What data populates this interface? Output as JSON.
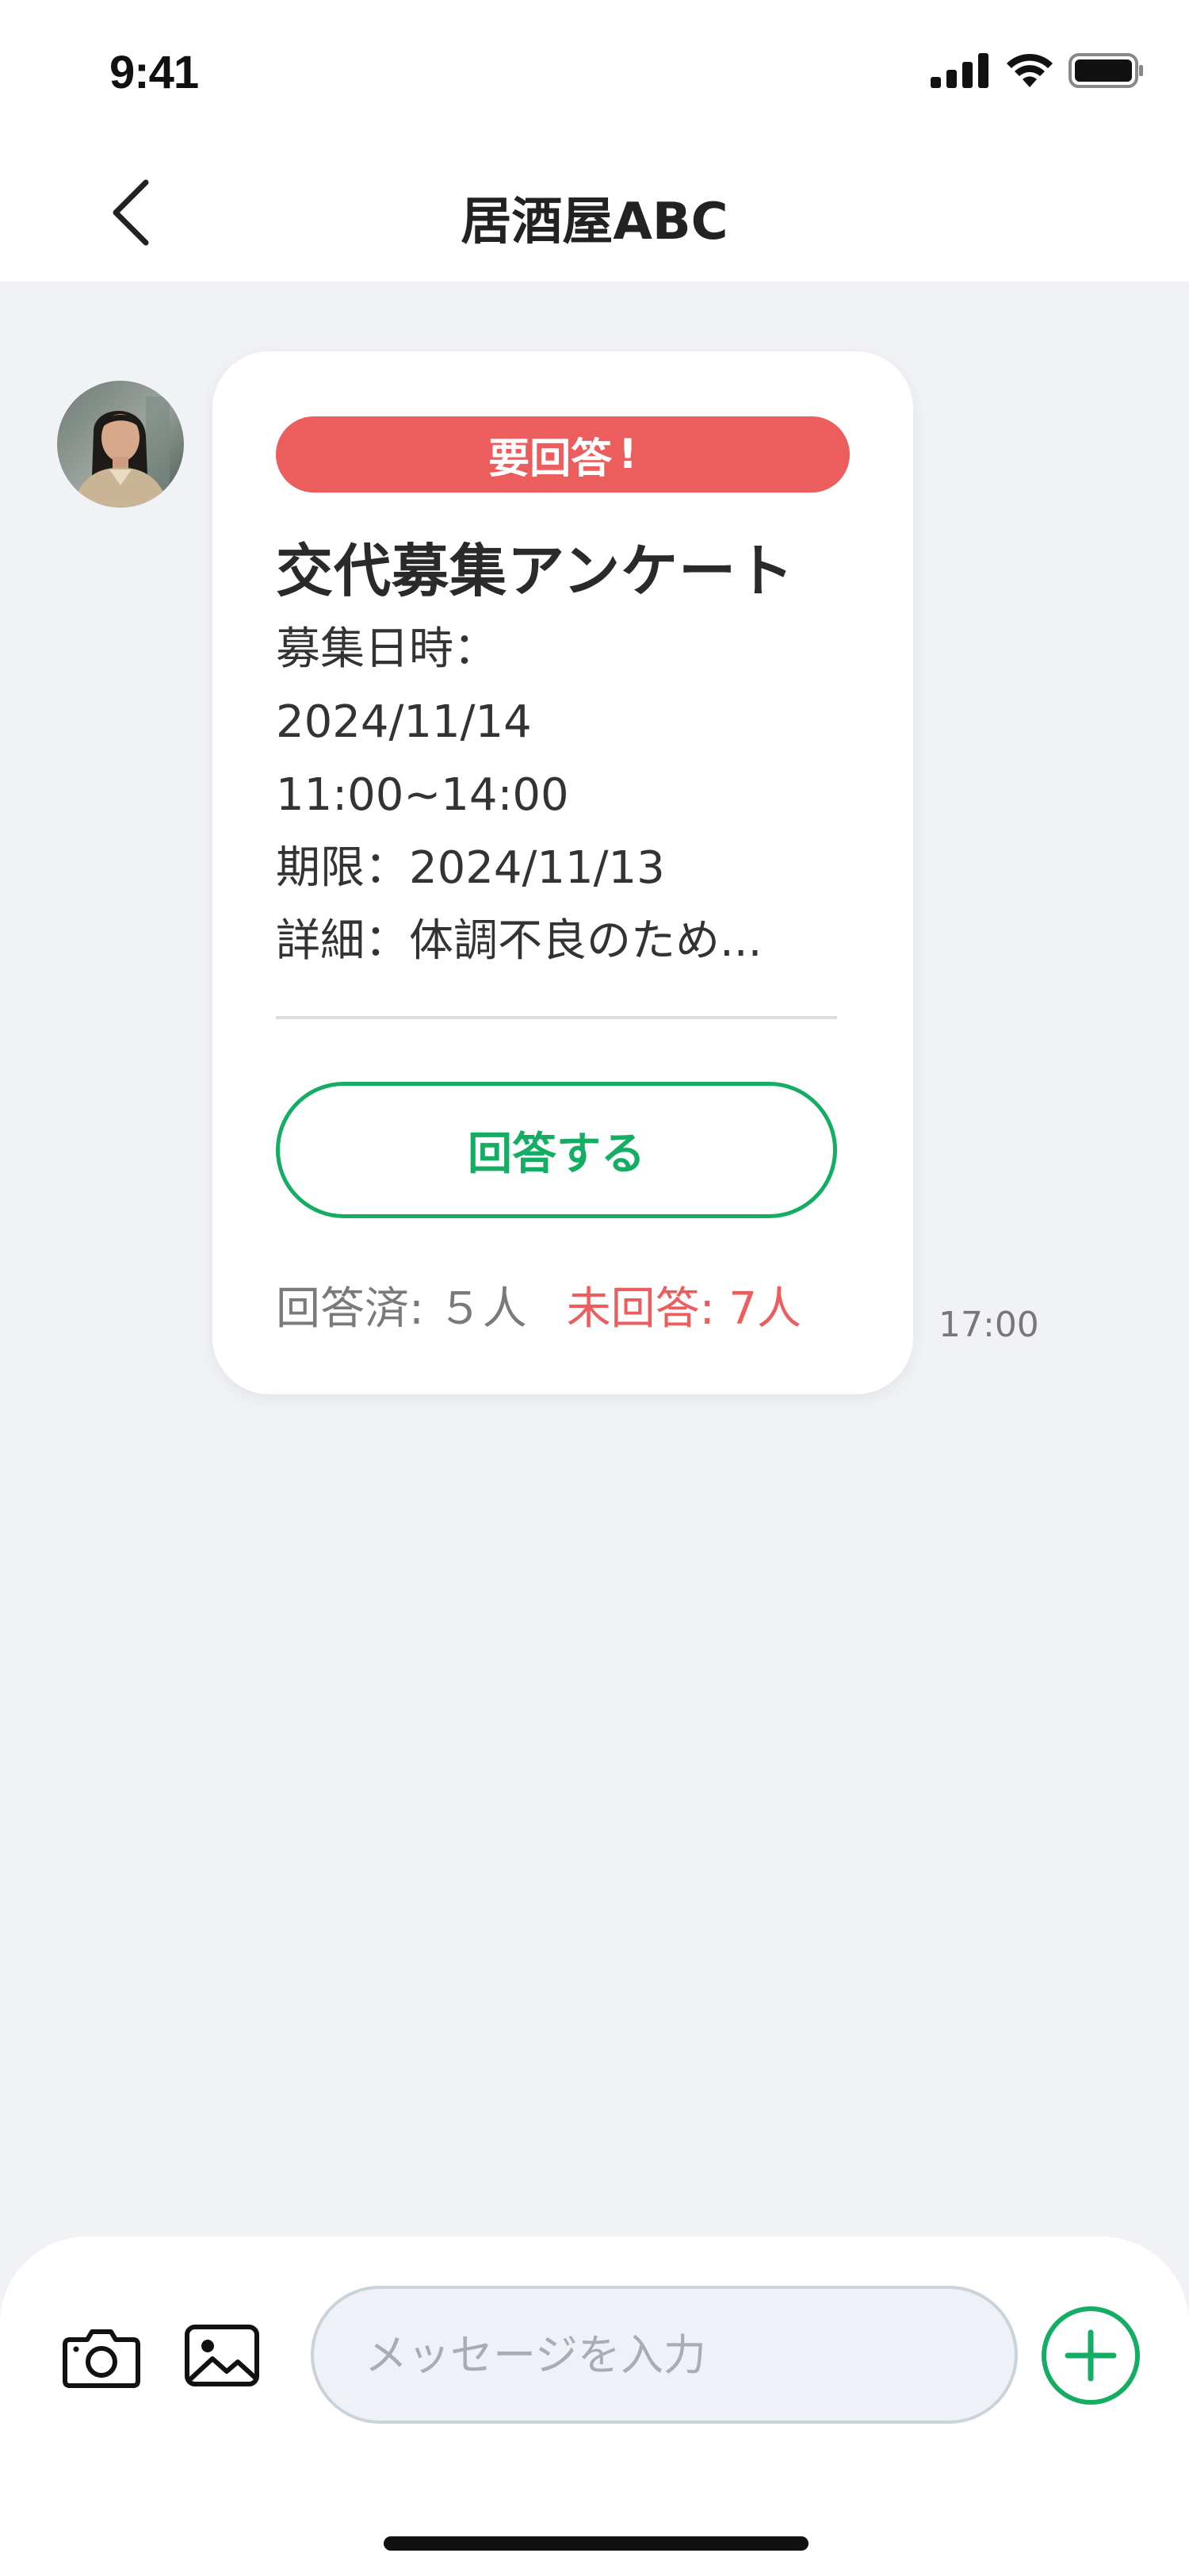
{
  "status_bar": {
    "time": "9:41"
  },
  "header": {
    "title": "居酒屋ABC"
  },
  "message": {
    "badge_label": "要回答",
    "badge_mark": "!",
    "title": "交代募集アンケート",
    "lines": [
      "募集日時：",
      "2024/11/14",
      "11:00~14:00",
      "期限：2024/11/13",
      "詳細：体調不良のため..."
    ],
    "answer_button_label": "回答する",
    "answered_text": "回答済: ５人",
    "unanswered_text": "未回答: 7人",
    "time": "17:00"
  },
  "composer": {
    "placeholder": "メッセージを入力"
  },
  "colors": {
    "accent_green": "#14ad63",
    "alert_red": "#ec5d5e",
    "background": "#f0f2f6"
  }
}
